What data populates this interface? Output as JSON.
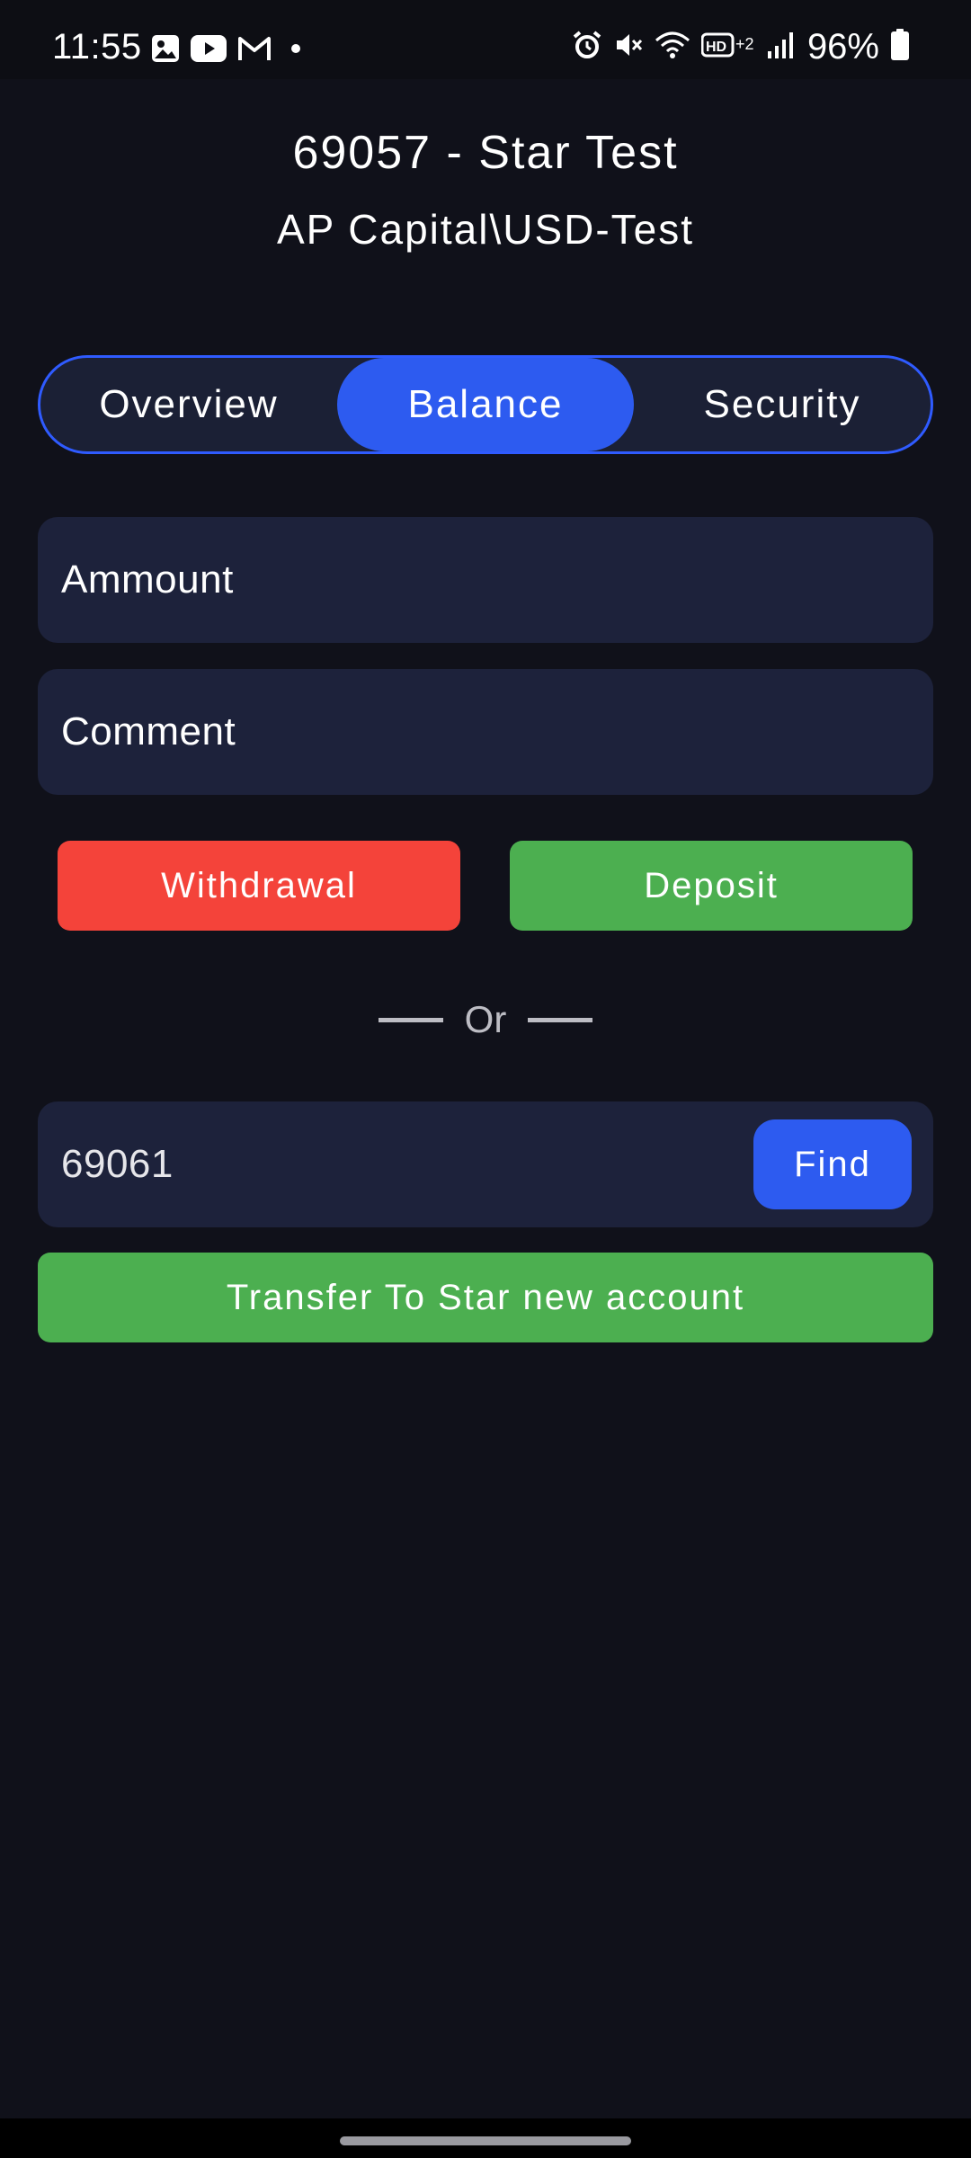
{
  "status_bar": {
    "time": "11:55",
    "battery": "96%",
    "left_icons": [
      "gallery-icon",
      "youtube-icon",
      "gmail-icon",
      "dot-icon"
    ],
    "right_icons": [
      "alarm-icon",
      "mute-icon",
      "wifi-icon",
      "hd-voice-icon",
      "signal-icon",
      "battery-icon"
    ]
  },
  "header": {
    "title": "69057 - Star Test",
    "subtitle": "AP Capital\\USD-Test"
  },
  "tabs": [
    {
      "label": "Overview",
      "active": false
    },
    {
      "label": "Balance",
      "active": true
    },
    {
      "label": "Security",
      "active": false
    }
  ],
  "form": {
    "amount_placeholder": "Ammount",
    "comment_placeholder": "Comment",
    "withdrawal_label": "Withdrawal",
    "deposit_label": "Deposit"
  },
  "divider": {
    "text": "Or"
  },
  "transfer": {
    "account_value": "69061",
    "find_label": "Find",
    "transfer_label": "Transfer To Star new account"
  },
  "colors": {
    "background": "#10111a",
    "accent": "#2d5bf0",
    "field": "#1d223b",
    "danger": "#f4433a",
    "success": "#4caf50"
  }
}
